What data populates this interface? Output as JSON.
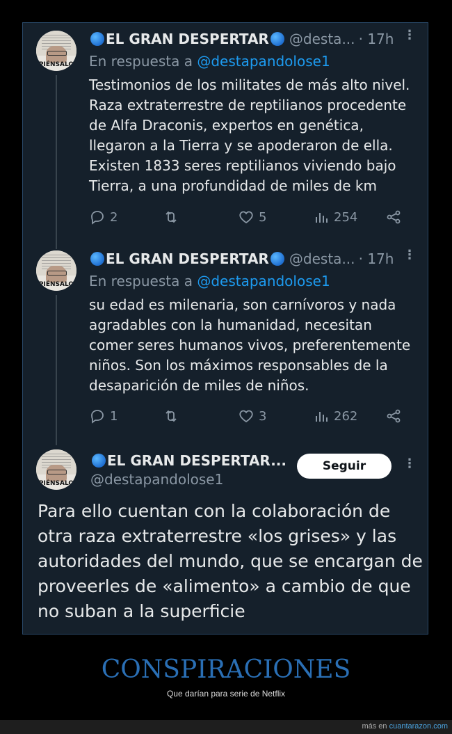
{
  "tweets": [
    {
      "name": "EL GRAN DESPERTAR",
      "handle": "@desta...",
      "time": "· 17h",
      "reply_prefix": "En respuesta a",
      "reply_handle": "@destapandolose1",
      "text": "Testimonios de los militates de más alto nivel. Raza extraterrestre de reptilianos  procedente de Alfa Draconis, expertos en genética, llegaron a la Tierra y se apoderaron de ella. Existen 1833 seres reptilianos viviendo bajo Tierra, a una profundidad de miles de km",
      "replies": "2",
      "likes": "5",
      "views": "254"
    },
    {
      "name": "EL GRAN DESPERTAR",
      "handle": "@desta...",
      "time": "· 17h",
      "reply_prefix": "En respuesta a",
      "reply_handle": "@destapandolose1",
      "text": "su edad es milenaria, son carnívoros y nada agradables con la humanidad, necesitan comer seres humanos vivos, preferentemente niños. Son los máximos responsables de  la desaparición de miles de niños.",
      "replies": "1",
      "likes": "3",
      "views": "262"
    }
  ],
  "main_tweet": {
    "name": "EL GRAN DESPERTAR...",
    "handle": "@destapandolose1",
    "follow_label": "Seguir",
    "text": "Para ello cuentan con la colaboración de otra raza extraterrestre «los grises» y las autoridades del mundo,  que se encargan de proveerles de «alimento» a cambio de que no suban a la superficie"
  },
  "avatar_label": "PIÉNSALO",
  "footer": {
    "title": "CONSPIRACIONES",
    "subtitle": "Que darían para serie de Netflix",
    "credit_prefix": "más en",
    "credit_site": "cuantarazon.com"
  },
  "icons": {
    "reply": "reply-icon",
    "retweet": "retweet-icon",
    "like": "heart-icon",
    "views": "views-icon",
    "share": "share-icon",
    "more": "more-icon",
    "verified": "globe-icon"
  },
  "colors": {
    "background": "#15202b",
    "text": "#e7e9ea",
    "muted": "#8b98a5",
    "link": "#1d9bf0",
    "footer_title": "#2a6fb5"
  }
}
